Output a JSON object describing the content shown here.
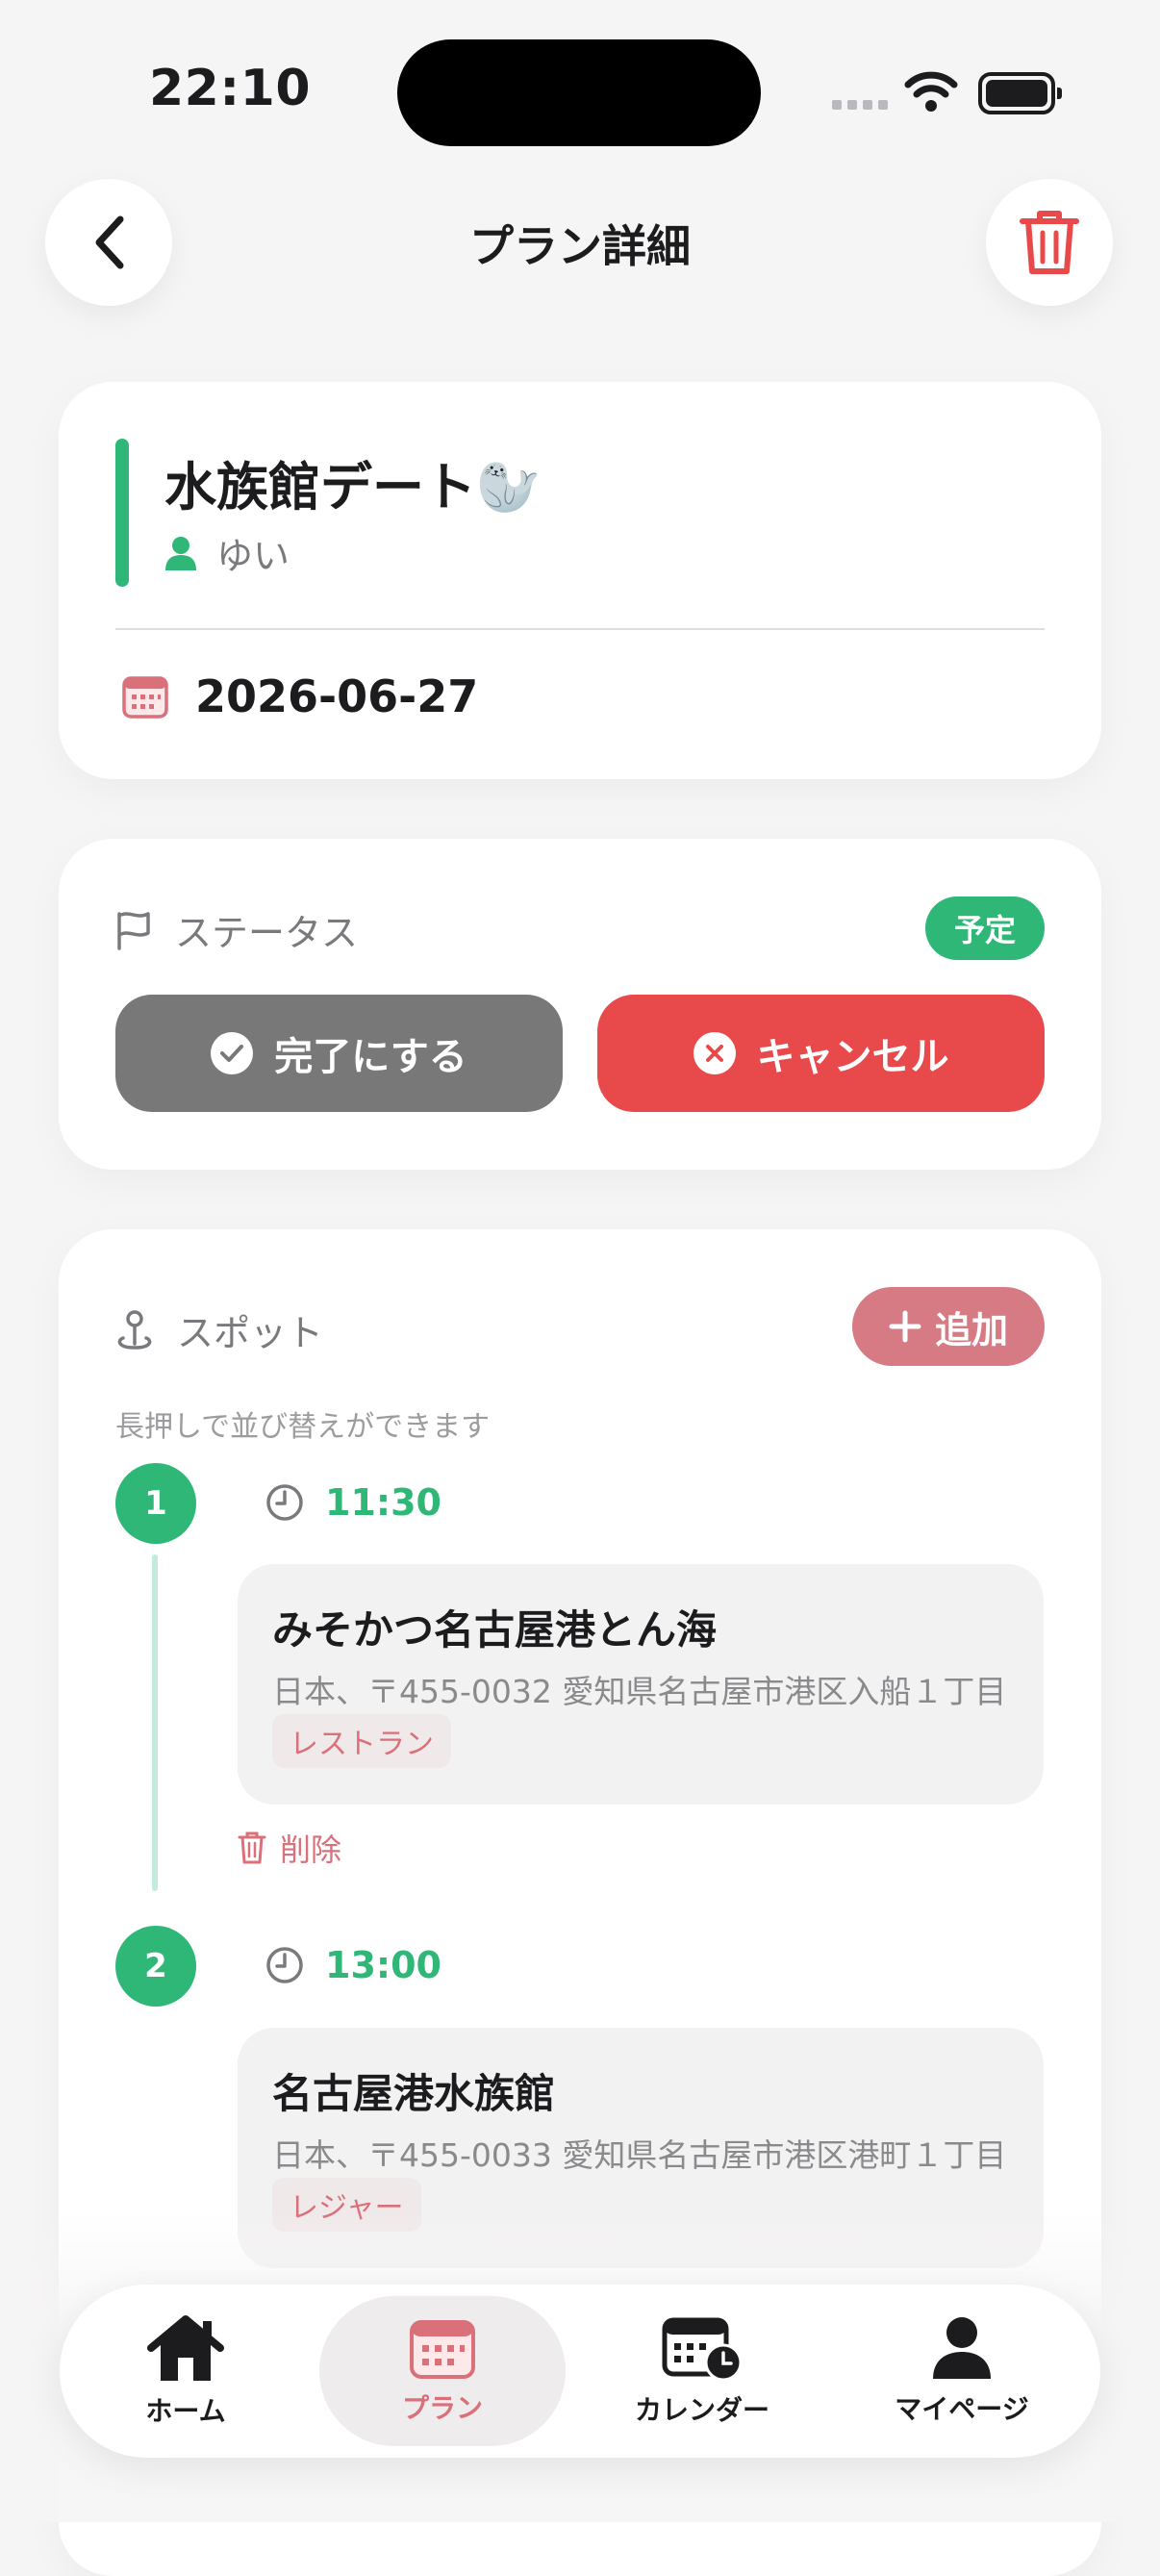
{
  "status_bar": {
    "time": "22:10"
  },
  "header": {
    "title": "プラン詳細"
  },
  "plan": {
    "title": "水族館デート🦭",
    "person": "ゆい",
    "date": "2026-06-27"
  },
  "status_section": {
    "label": "ステータス",
    "badge": "予定",
    "complete_label": "完了にする",
    "cancel_label": "キャンセル"
  },
  "spots_section": {
    "label": "スポット",
    "add_label": "追加",
    "hint": "長押しで並び替えができます",
    "delete_label": "削除",
    "items": [
      {
        "number": "1",
        "time": "11:30",
        "name": "みそかつ名古屋港とん海",
        "address": "日本、〒455-0032 愛知県名古屋市港区入船１丁目",
        "category": "レストラン"
      },
      {
        "number": "2",
        "time": "13:00",
        "name": "名古屋港水族館",
        "address": "日本、〒455-0033 愛知県名古屋市港区港町１丁目",
        "category": "レジャー"
      }
    ]
  },
  "tabbar": {
    "tabs": [
      {
        "label": "ホーム"
      },
      {
        "label": "プラン"
      },
      {
        "label": "カレンダー"
      },
      {
        "label": "マイページ"
      }
    ],
    "active": "プラン"
  },
  "colors": {
    "accent_green": "#2fb778",
    "danger_red": "#e84a4c",
    "pink": "#d9707a",
    "gray_button": "#787878"
  }
}
